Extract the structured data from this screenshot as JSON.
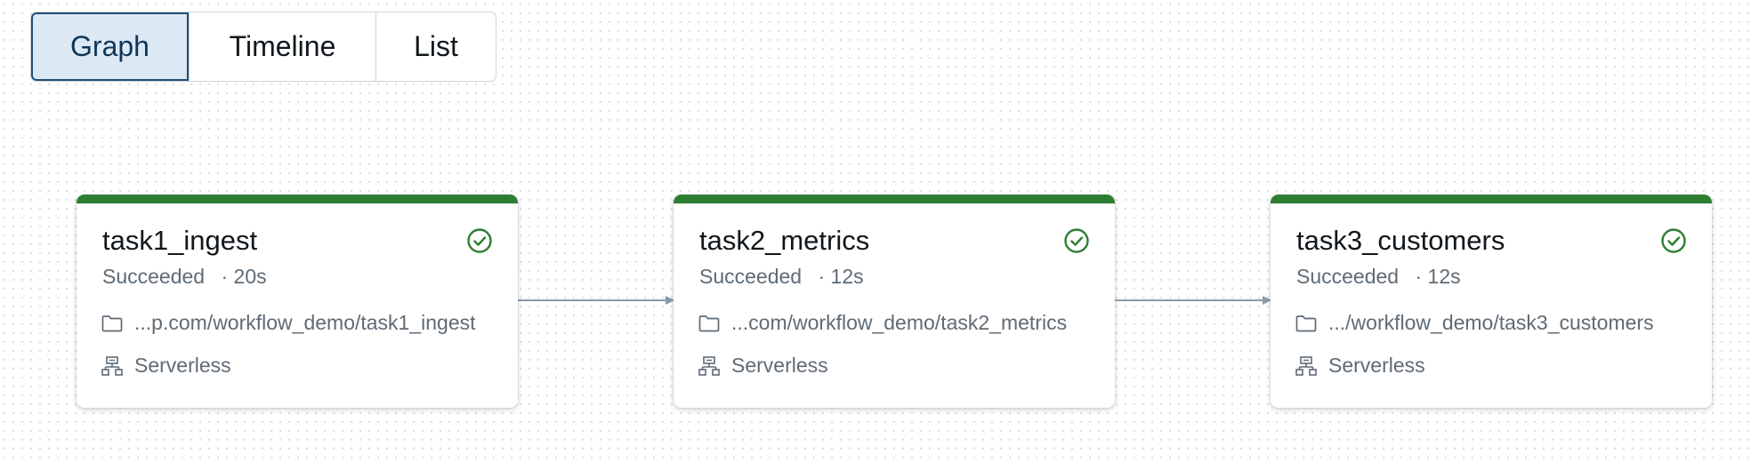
{
  "view_tabs": [
    {
      "label": "Graph",
      "active": true
    },
    {
      "label": "Timeline",
      "active": false
    },
    {
      "label": "List",
      "active": false
    }
  ],
  "colors": {
    "success": "#2e7d32",
    "edge": "#8a99ab",
    "active_tab_bg": "#dce8f4",
    "active_tab_border": "#1f4e79"
  },
  "tasks": [
    {
      "name": "task1_ingest",
      "status": "Succeeded",
      "duration": "20s",
      "path": "...p.com/workflow_demo/task1_ingest",
      "compute": "Serverless",
      "status_icon": "check-circle-icon",
      "path_icon": "folder-icon",
      "compute_icon": "network-icon"
    },
    {
      "name": "task2_metrics",
      "status": "Succeeded",
      "duration": "12s",
      "path": "...com/workflow_demo/task2_metrics",
      "compute": "Serverless",
      "status_icon": "check-circle-icon",
      "path_icon": "folder-icon",
      "compute_icon": "network-icon"
    },
    {
      "name": "task3_customers",
      "status": "Succeeded",
      "duration": "12s",
      "path": ".../workflow_demo/task3_customers",
      "compute": "Serverless",
      "status_icon": "check-circle-icon",
      "path_icon": "folder-icon",
      "compute_icon": "network-icon"
    }
  ]
}
